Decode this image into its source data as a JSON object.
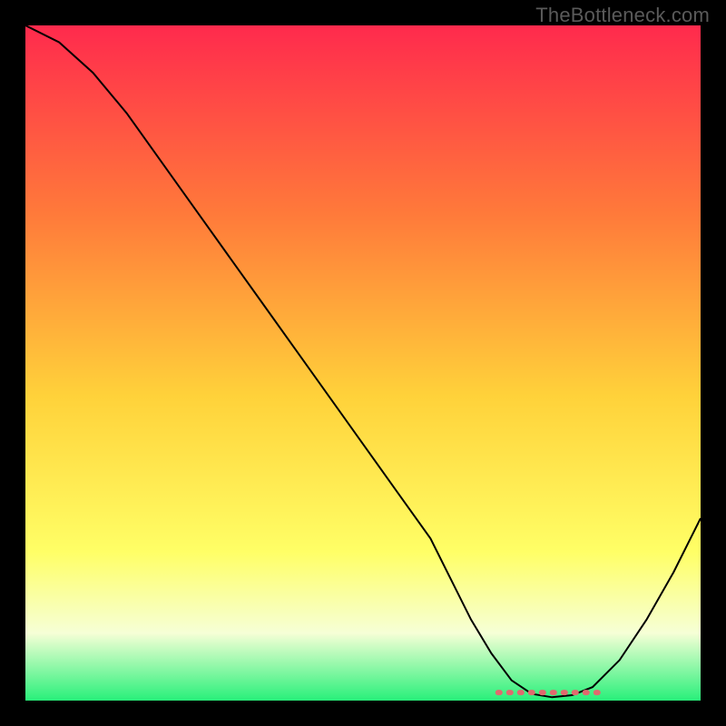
{
  "watermark": "TheBottleneck.com",
  "chart_data": {
    "type": "line",
    "title": "",
    "xlabel": "",
    "ylabel": "",
    "xlim": [
      0,
      100
    ],
    "ylim": [
      0,
      100
    ],
    "background_gradient": {
      "top": "#ff2a4d",
      "upper_mid": "#ff7a3a",
      "mid": "#ffd23a",
      "lower_mid": "#ffff66",
      "lower": "#f6ffd6",
      "bottom": "#28f07a"
    },
    "series": [
      {
        "name": "bottleneck-curve",
        "color": "#000000",
        "stroke_width": 2,
        "x": [
          0,
          5,
          10,
          15,
          20,
          25,
          30,
          35,
          40,
          45,
          50,
          55,
          60,
          63,
          66,
          69,
          72,
          75,
          78,
          81,
          84,
          88,
          92,
          96,
          100
        ],
        "y": [
          100,
          97.5,
          93,
          87,
          80,
          73,
          66,
          59,
          52,
          45,
          38,
          31,
          24,
          18,
          12,
          7,
          3,
          1,
          0.5,
          0.8,
          2,
          6,
          12,
          19,
          27
        ]
      }
    ],
    "flat_region": {
      "name": "optimal-marker",
      "color": "#e06a6e",
      "stroke_width": 6,
      "dash": "2,10",
      "x_start": 70,
      "x_end": 85,
      "y": 1.2
    }
  }
}
